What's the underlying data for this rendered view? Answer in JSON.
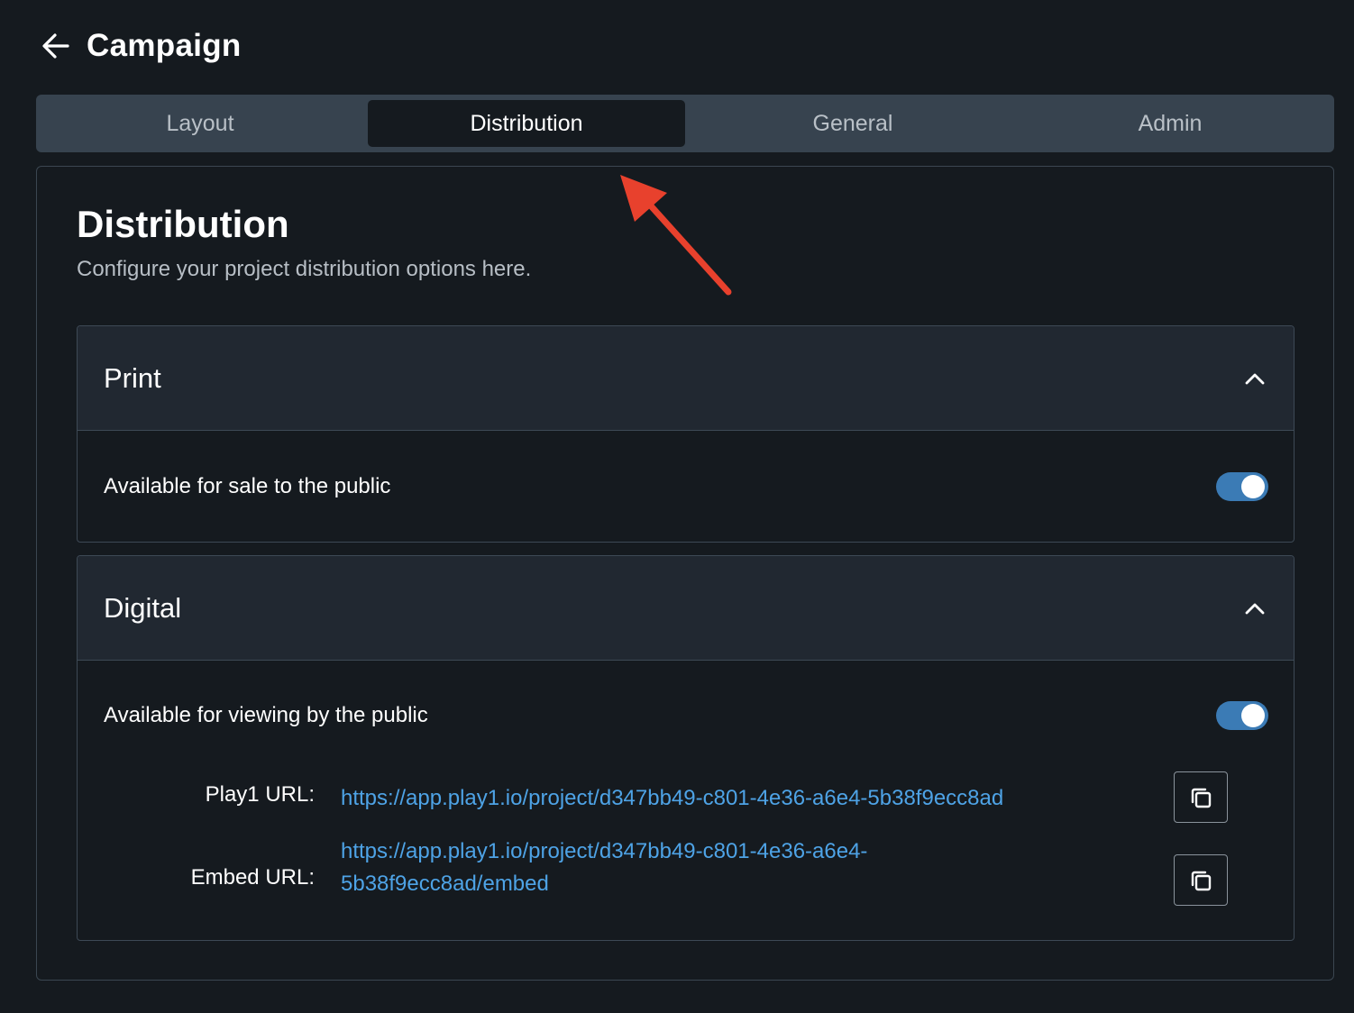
{
  "header": {
    "title": "Campaign",
    "back_icon": "arrow-left-icon"
  },
  "tabs": [
    {
      "label": "Layout",
      "active": false
    },
    {
      "label": "Distribution",
      "active": true
    },
    {
      "label": "General",
      "active": false
    },
    {
      "label": "Admin",
      "active": false
    }
  ],
  "card": {
    "title": "Distribution",
    "description": "Configure your project distribution options here."
  },
  "print": {
    "title": "Print",
    "expanded": true,
    "sale_label": "Available for sale to the public",
    "sale_enabled": true
  },
  "digital": {
    "title": "Digital",
    "expanded": true,
    "view_label": "Available for viewing by the public",
    "view_enabled": true,
    "play_label": "Play1 URL:",
    "play_url": "https://app.play1.io/project/d347bb49-c801-4e36-a6e4-5b38f9ecc8ad",
    "embed_label": "Embed URL:",
    "embed_url_line1": "https://app.play1.io/project/d347bb49-c801-4e36-a6e4-",
    "embed_url_line2": "5b38f9ecc8ad/embed"
  },
  "colors": {
    "background": "#151a1f",
    "tabbar": "#37434f",
    "section_header": "#212831",
    "toggle_on": "#3b7bb5",
    "link": "#4ea3e6",
    "annotation_arrow": "#e8412d"
  }
}
